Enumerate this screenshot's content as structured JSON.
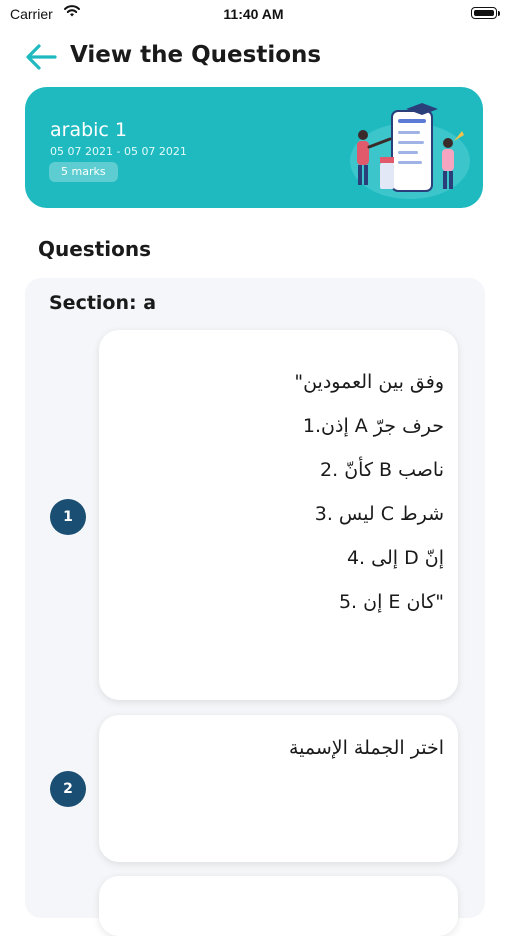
{
  "status_bar": {
    "carrier": "Carrier",
    "time": "11:40 AM"
  },
  "header": {
    "title": "View the Questions"
  },
  "exam": {
    "name": "arabic 1",
    "dates": "05 07 2021 - 05 07 2021",
    "marks": "5 marks"
  },
  "questions_heading": "Questions",
  "section": {
    "title": "Section: a"
  },
  "questions": [
    {
      "number": "1",
      "lines": [
        "وفق بين العمودين\"",
        "حرف جرّ A إذن.1",
        "ناصب B كأنّ .2",
        "شرط C ليس .3",
        "إنّ D إلى .4",
        "\"كان E إن .5"
      ]
    },
    {
      "number": "2",
      "text": "اختر الجملة الإسمية"
    }
  ],
  "colors": {
    "card_teal": "#1fbac0",
    "badge_navy": "#1a4e73",
    "back_arrow": "#1fbac0",
    "panel_bg": "#f4f6f9"
  },
  "icons": {
    "back": "arrow-left-icon",
    "wifi": "wifi-icon",
    "battery": "battery-icon"
  }
}
